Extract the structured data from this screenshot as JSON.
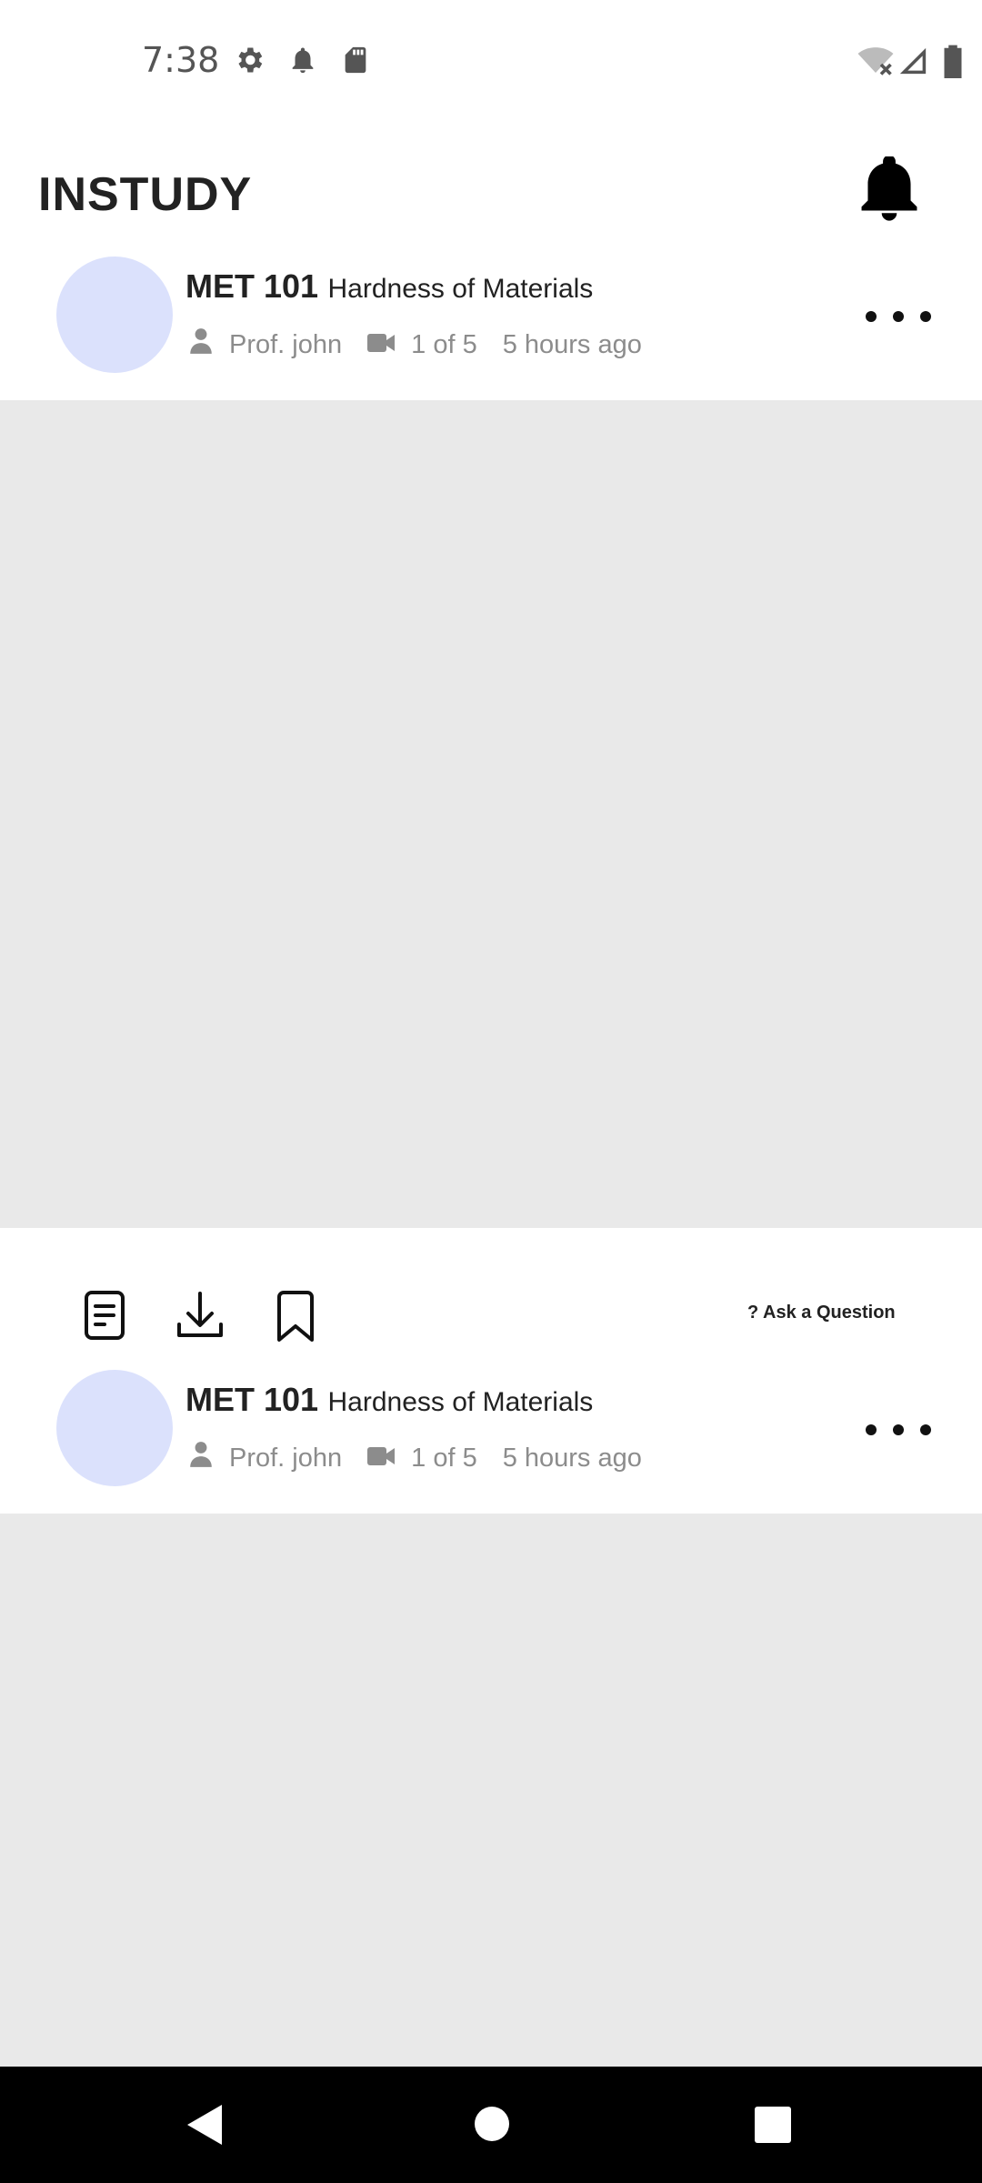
{
  "status_bar": {
    "time": "7:38",
    "icons": [
      "settings-icon",
      "notification-icon",
      "sd-card-icon",
      "wifi-off-icon",
      "signal-icon",
      "battery-icon"
    ]
  },
  "header": {
    "title": "INSTUDY",
    "icon": "bell-icon"
  },
  "posts": [
    {
      "course_code": "MET 101",
      "course_title": "Hardness of Materials",
      "author": "Prof. john",
      "video_index": "1 of 5",
      "time_ago": "5 hours ago"
    },
    {
      "course_code": "MET 101",
      "course_title": "Hardness of Materials",
      "author": "Prof. john",
      "video_index": "1 of 5",
      "time_ago": "5 hours ago"
    }
  ],
  "actions": {
    "icons": [
      "document-icon",
      "download-icon",
      "bookmark-icon"
    ],
    "ask_label": "? Ask a Question"
  },
  "colors": {
    "avatar": "#dbe1fc",
    "video_placeholder": "#e9e9e9",
    "meta_text": "#8c8c8c"
  }
}
